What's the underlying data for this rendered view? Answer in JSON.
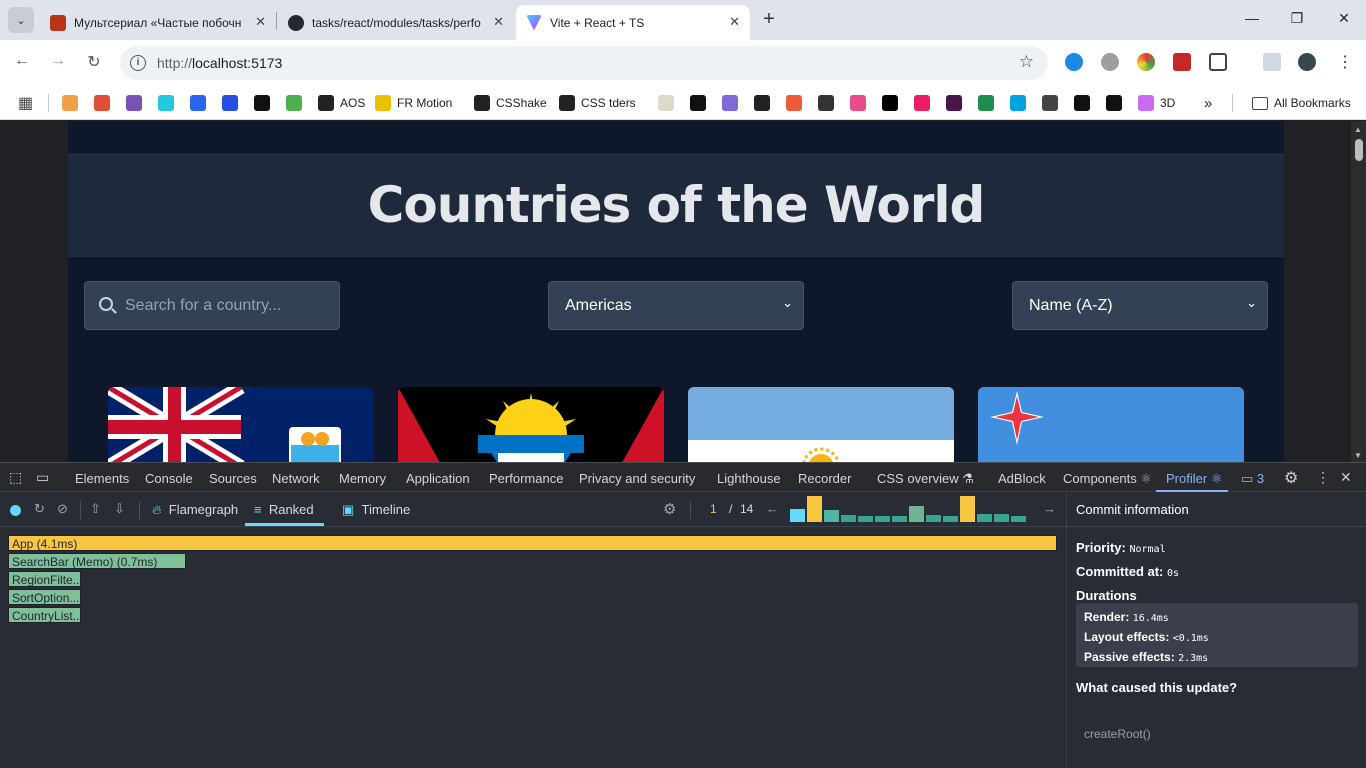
{
  "browser": {
    "tabs": [
      {
        "title": "Мультсериал «Частые побочн",
        "favicon_color": "#b8331a"
      },
      {
        "title": "tasks/react/modules/tasks/perfo",
        "favicon_color": "#24292f"
      },
      {
        "title": "Vite + React + TS",
        "favicon_color": "#8c5cff"
      }
    ],
    "active_tab_index": 2,
    "url_scheme": "http://",
    "url_host": "localhost:5173",
    "bookmarks": [
      {
        "label": "",
        "color": "#f0a04b"
      },
      {
        "label": "",
        "color": "#e04e39"
      },
      {
        "label": "",
        "color": "#7952b3"
      },
      {
        "label": "",
        "color": "#24c8db"
      },
      {
        "label": "",
        "color": "#2965f1"
      },
      {
        "label": "",
        "color": "#264de4"
      },
      {
        "label": "",
        "color": "#111111"
      },
      {
        "label": "",
        "color": "#4caf50"
      },
      {
        "label": "AOS",
        "color": "#222222"
      },
      {
        "label": "FR Motion",
        "color": "#e8c200"
      },
      {
        "label": "CSShake",
        "color": "#222222"
      },
      {
        "label": "CSS tders",
        "color": "#222222"
      },
      {
        "label": "",
        "color": "#e0d8c8"
      },
      {
        "label": "",
        "color": "#111111"
      },
      {
        "label": "",
        "color": "#7f6ad7"
      },
      {
        "label": "",
        "color": "#222222"
      },
      {
        "label": "",
        "color": "#ef5a3a"
      },
      {
        "label": "",
        "color": "#333333"
      },
      {
        "label": "",
        "color": "#ea4c89"
      },
      {
        "label": "",
        "color": "#000000"
      },
      {
        "label": "",
        "color": "#e91e63"
      },
      {
        "label": "",
        "color": "#4a154b"
      },
      {
        "label": "",
        "color": "#1e8c4e"
      },
      {
        "label": "",
        "color": "#00a3e0"
      },
      {
        "label": "",
        "color": "#444444"
      },
      {
        "label": "",
        "color": "#111111"
      },
      {
        "label": "",
        "color": "#111111"
      },
      {
        "label": "3D",
        "color": "#c56cf0"
      }
    ],
    "all_bookmarks_label": "All Bookmarks"
  },
  "app": {
    "title": "Countries of the World",
    "search_placeholder": "Search for a country...",
    "region_value": "Americas",
    "sort_value": "Name (A-Z)"
  },
  "devtools": {
    "tabs": [
      "Elements",
      "Console",
      "Sources",
      "Network",
      "Memory",
      "Application",
      "Performance",
      "Privacy and security",
      "Lighthouse",
      "Recorder",
      "CSS overview",
      "AdBlock",
      "Components",
      "Profiler"
    ],
    "active_tab": "Profiler",
    "issues_count": "3",
    "profiler": {
      "view_flamegraph": "Flamegraph",
      "view_ranked": "Ranked",
      "view_timeline": "Timeline",
      "commit_index": "1",
      "commit_separator": "/",
      "commit_total": "14",
      "commit_levels": [
        0.5,
        1.0,
        0.45,
        0.28,
        0.22,
        0.22,
        0.22,
        0.62,
        0.28,
        0.22,
        1.0,
        0.3,
        0.3,
        0.22
      ],
      "commit_colors": [
        "#61dafb",
        "#f9c642",
        "#4db6a0",
        "#3aa394",
        "#3aa394",
        "#3aa394",
        "#3aa394",
        "#6fb592",
        "#3aa394",
        "#3aa394",
        "#f9c642",
        "#3aa394",
        "#3aa394",
        "#3aa394"
      ],
      "ranked": [
        {
          "label": "App (4.1ms)",
          "fraction": 1.0,
          "kind": "app"
        },
        {
          "label": "SearchBar (Memo) (0.7ms)",
          "fraction": 0.17,
          "kind": "child"
        },
        {
          "label": "RegionFilte...",
          "fraction": 0.07,
          "kind": "child"
        },
        {
          "label": "SortOption...",
          "fraction": 0.07,
          "kind": "child"
        },
        {
          "label": "CountryList...",
          "fraction": 0.07,
          "kind": "child"
        }
      ],
      "commit_info": {
        "header": "Commit information",
        "priority_label": "Priority:",
        "priority_value": "Normal",
        "committed_label": "Committed at:",
        "committed_value": "0s",
        "durations_label": "Durations",
        "render_label": "Render:",
        "render_value": "16.4ms",
        "layout_label": "Layout effects:",
        "layout_value": "<0.1ms",
        "passive_label": "Passive effects:",
        "passive_value": "2.3ms",
        "cause_label": "What caused this update?",
        "cause_value": "createRoot()"
      }
    }
  }
}
